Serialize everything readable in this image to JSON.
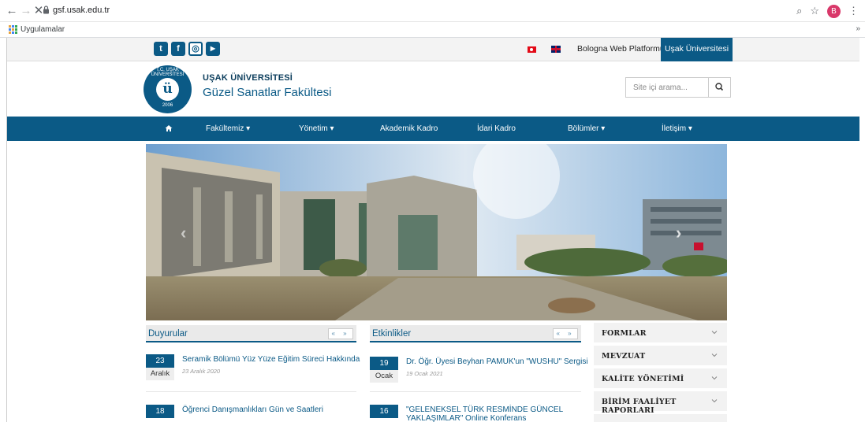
{
  "browser": {
    "url": "gsf.usak.edu.tr",
    "bookmarks_label": "Uygulamalar",
    "profile_initial": "B"
  },
  "topbar": {
    "social_icons": [
      "twitter-icon",
      "facebook-icon",
      "instagram-icon",
      "youtube-icon"
    ],
    "bologna_label": "Bologna Web Platformu",
    "university_button": "Uşak Üniversitesi"
  },
  "header": {
    "logo_ring_text": "T.C. UŞAK ÜNİVERSİTESİ",
    "logo_year": "2006",
    "university_name": "UŞAK ÜNİVERSİTESİ",
    "faculty_name": "Güzel Sanatlar Fakültesi",
    "search_placeholder": "Site içi arama..."
  },
  "nav": {
    "items": [
      "Fakültemiz ▾",
      "Yönetim ▾",
      "Akademik Kadro",
      "İdari Kadro",
      "Bölümler ▾",
      "İletişim ▾"
    ]
  },
  "announcements": {
    "title": "Duyurular",
    "pager": "« »",
    "items": [
      {
        "day": "23",
        "month": "Aralık",
        "title": "Seramik Bölümü Yüz Yüze Eğitim Süreci Hakkında",
        "date": "23 Aralık 2020"
      },
      {
        "day": "18",
        "month": "",
        "title": "Öğrenci Danışmanlıkları Gün ve Saatleri",
        "date": ""
      }
    ]
  },
  "events": {
    "title": "Etkinlikler",
    "pager": "« »",
    "items": [
      {
        "day": "19",
        "month": "Ocak",
        "title": "Dr. Öğr. Üyesi Beyhan PAMUK'un \"WUSHU\" Sergisi",
        "date": "19 Ocak 2021"
      },
      {
        "day": "16",
        "month": "",
        "title": "\"GELENEKSEL TÜRK RESMİNDE GÜNCEL YAKLAŞIMLAR\" Online Konferans",
        "date": ""
      }
    ]
  },
  "sidebar": {
    "items": [
      "FORMLAR",
      "MEVZUAT",
      "KALİTE YÖNETİMİ",
      "BİRİM FAALİYET RAPORLARI"
    ]
  },
  "colors": {
    "brand": "#0b5a86"
  }
}
